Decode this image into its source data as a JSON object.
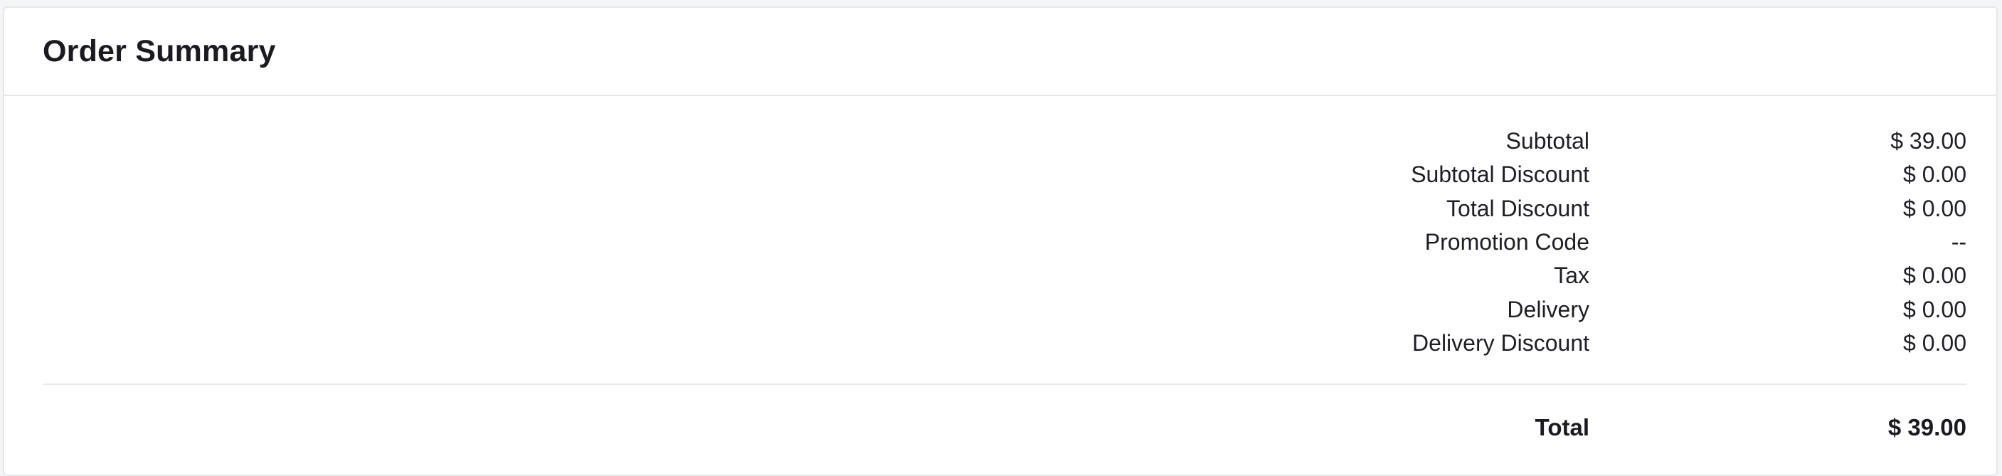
{
  "card": {
    "title": "Order Summary"
  },
  "summary": {
    "rows": [
      {
        "label": "Subtotal",
        "value": "$ 39.00"
      },
      {
        "label": "Subtotal Discount",
        "value": "$ 0.00"
      },
      {
        "label": "Total Discount",
        "value": "$ 0.00"
      },
      {
        "label": "Promotion Code",
        "value": "--"
      },
      {
        "label": "Tax",
        "value": "$ 0.00"
      },
      {
        "label": "Delivery",
        "value": "$ 0.00"
      },
      {
        "label": "Delivery Discount",
        "value": "$ 0.00"
      }
    ],
    "total": {
      "label": "Total",
      "value": "$ 39.00"
    }
  },
  "colors": {
    "text": "#1d1d21",
    "border": "#e6e7ea",
    "background": "#ffffff"
  }
}
